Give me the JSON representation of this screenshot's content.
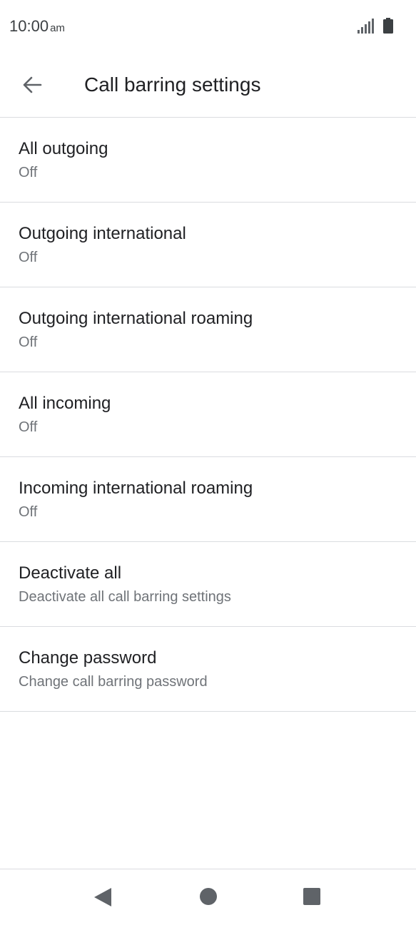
{
  "status_bar": {
    "time": "10:00",
    "ampm": "am",
    "icons": [
      "signal-icon",
      "battery-icon"
    ]
  },
  "app_bar": {
    "back_icon": "arrow-back-icon",
    "title": "Call barring settings"
  },
  "settings": [
    {
      "title": "All outgoing",
      "summary": "Off"
    },
    {
      "title": "Outgoing international",
      "summary": "Off"
    },
    {
      "title": "Outgoing international roaming",
      "summary": "Off"
    },
    {
      "title": "All incoming",
      "summary": "Off"
    },
    {
      "title": "Incoming international roaming",
      "summary": "Off"
    },
    {
      "title": "Deactivate all",
      "summary": "Deactivate all call barring settings"
    },
    {
      "title": "Change password",
      "summary": "Change call barring password"
    }
  ],
  "nav_bar": {
    "icons": [
      "nav-back-icon",
      "nav-home-icon",
      "nav-recents-icon"
    ]
  },
  "colors": {
    "text_primary": "#202124",
    "text_secondary": "#6f7378",
    "divider": "#dadce0",
    "icon": "#5f6368"
  }
}
